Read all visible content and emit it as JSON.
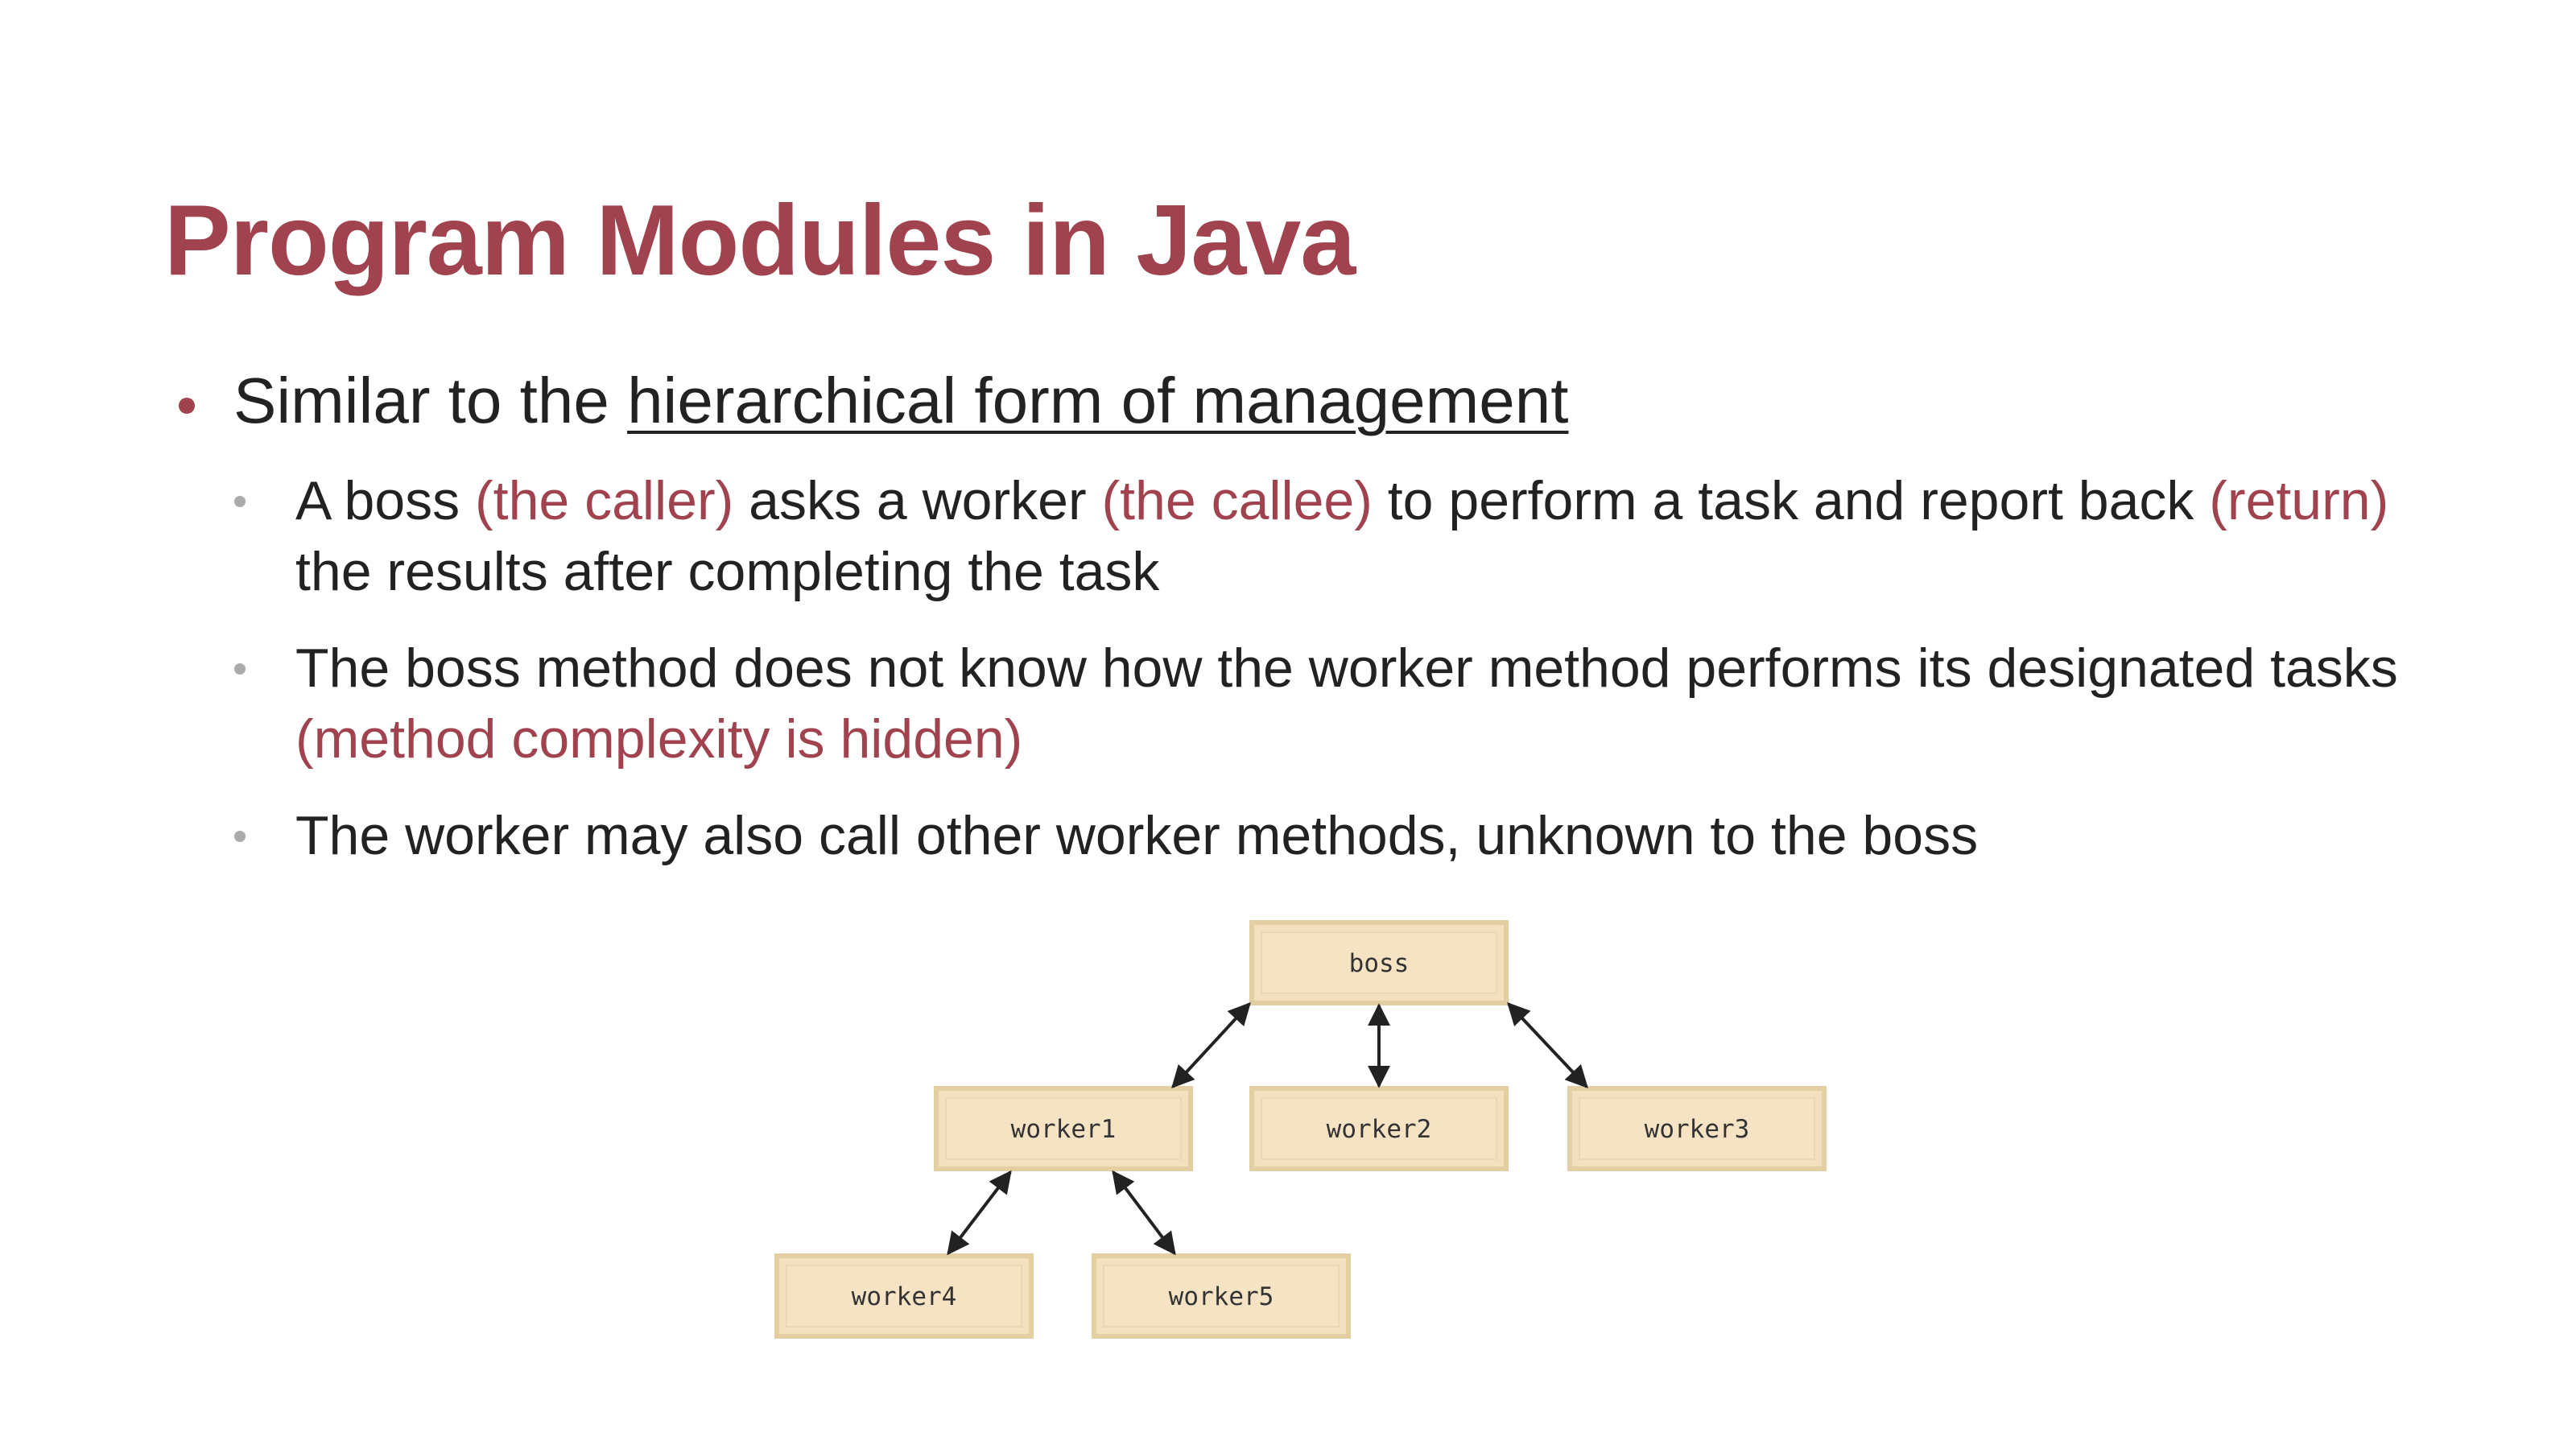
{
  "title": "Program Modules in Java",
  "bullet1": {
    "prefix": "Similar to the ",
    "underlined": "hierarchical form of management"
  },
  "sub1": {
    "t1": "A boss ",
    "h1": "(the caller)",
    "t2": " asks a worker ",
    "h2": "(the callee)",
    "t3": " to perform a task and report back ",
    "h3": "(return)",
    "t4": " the results after completing the task"
  },
  "sub2": {
    "t1": "The boss method does not know how the worker method performs its designated tasks ",
    "h1": "(method complexity is hidden)"
  },
  "sub3": {
    "t1": "The worker may also call other worker methods, unknown to the boss"
  },
  "diagram": {
    "boss": "boss",
    "worker1": "worker1",
    "worker2": "worker2",
    "worker3": "worker3",
    "worker4": "worker4",
    "worker5": "worker5"
  },
  "colors": {
    "accent": "#a0434f",
    "box_fill": "#f2e0bf",
    "box_border": "#e6d2a8"
  }
}
